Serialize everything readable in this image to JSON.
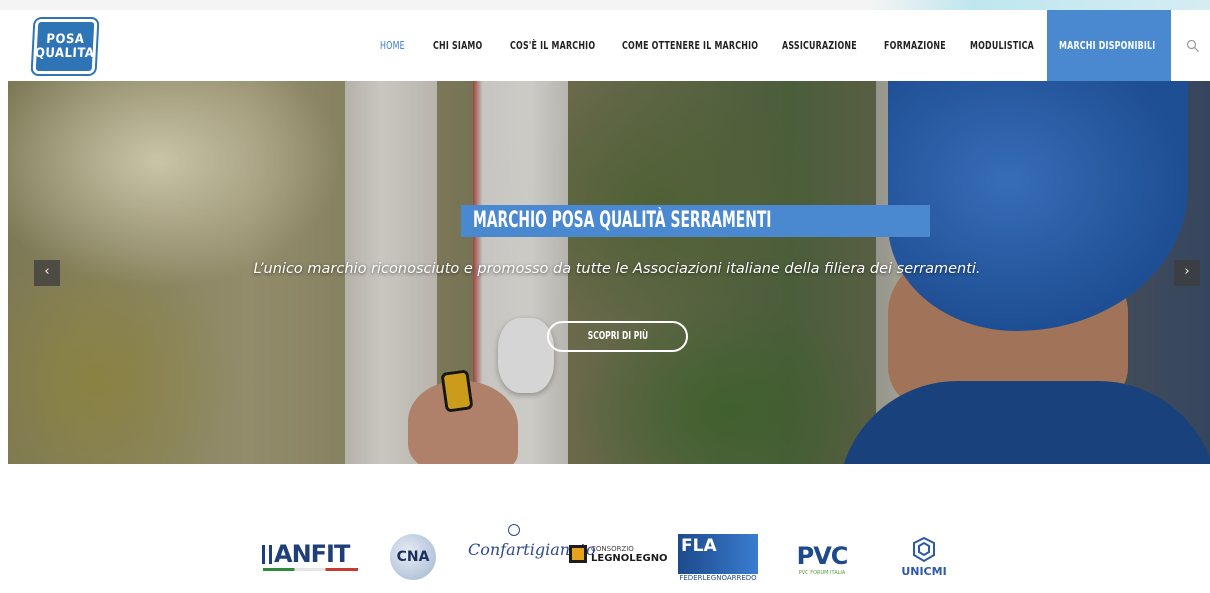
{
  "logo": {
    "line1": "POSA",
    "line2": "QUALITA"
  },
  "nav": {
    "items": [
      {
        "label": "HOME"
      },
      {
        "label": "CHI SIAMO"
      },
      {
        "label": "COS'È IL MARCHIO"
      },
      {
        "label": "COME OTTENERE IL MARCHIO"
      },
      {
        "label": "ASSICURAZIONE"
      },
      {
        "label": "FORMAZIONE"
      },
      {
        "label": "MODULISTICA"
      }
    ],
    "cta": "MARCHI DISPONIBILI",
    "search_icon": "search-icon"
  },
  "hero": {
    "title": "MARCHIO POSA QUALITÀ SERRAMENTI",
    "subtitle": "L’unico marchio riconosciuto e promosso da tutte le Associazioni italiane della filiera dei serramenti.",
    "button": "SCOPRI DI PIÙ",
    "prev": "‹",
    "next": "›"
  },
  "partners": {
    "anfit": "ANFIT",
    "cna": "CNA",
    "confartigianato": "Confartigianato",
    "consorzio_top": "CONSORZIO",
    "consorzio_bottom": "LEGNOLEGNO",
    "fla_top": "FLA",
    "fla_bottom": "FEDERLEGNOARREDO",
    "pvc_top": "PVC",
    "pvc_bottom": "PVC FORUM ITALIA",
    "unicmi": "UNICMI"
  },
  "colors": {
    "accent": "#4a89d0",
    "active_nav": "#3a7ccf"
  }
}
